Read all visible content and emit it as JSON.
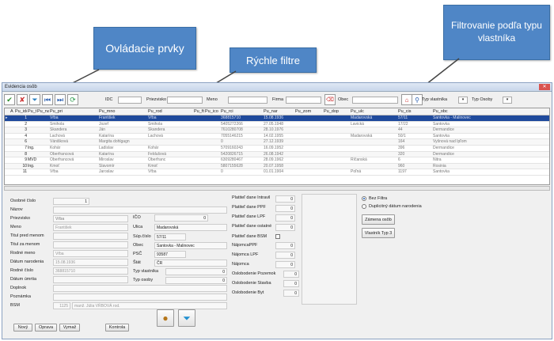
{
  "callouts": {
    "controls": "Ovládacie prvky",
    "quick_filters": "Rýchle filtre",
    "filter_by_type": "Filtrovanie podľa typu vlastníka"
  },
  "window": {
    "title": "Evidencia osôb",
    "close": "✕"
  },
  "toolbar": {
    "ok_icon": "✔",
    "cancel_icon": "✘",
    "filter_icon": "⏷",
    "prev_icon": "⏮",
    "next_icon": "⏭",
    "refresh_icon": "⟳"
  },
  "filters": {
    "idc_label": "IDC",
    "priezvisko_label": "Priezvisko",
    "meno_label": "Meno",
    "firma_label": "Firma",
    "obec_label": "Obec",
    "typ_vlastnika_label": "Typ vlastníka",
    "typ_osoby_label": "Typ Osoby"
  },
  "grid": {
    "columns": [
      "",
      "A",
      "Pu_idc",
      "Pu_ttp",
      "Pu_nac",
      "Pu_pri",
      "Pu_mno",
      "Pu_rod",
      "Pu_ftt",
      "Pu_ico",
      "Pu_rci",
      "Pu_nar",
      "Pu_zom",
      "Pu_dop",
      "Pu_ulc",
      "Pu_cis",
      "Pu_obc"
    ],
    "rows": [
      [
        "▸",
        "",
        "1",
        "",
        "",
        "Vŕba",
        "František",
        "Vŕba",
        "",
        "",
        "368815710",
        "15.08.1936",
        "",
        "",
        "Madarovská",
        "57/11",
        "Santovka - Malinovec"
      ],
      [
        "",
        "",
        "2",
        "",
        "",
        "Šmihola",
        "Jozef",
        "Šmihola",
        "",
        "",
        "5405272266",
        "27.05.1948",
        "",
        "",
        "Lavická",
        "17/22",
        "Santovka"
      ],
      [
        "",
        "",
        "3",
        "",
        "",
        "Škandera",
        "Ján",
        "Škandera",
        "",
        "",
        "7610280708",
        "28.10.1976",
        "",
        "",
        "",
        "44",
        "Dermandice"
      ],
      [
        "",
        "",
        "4",
        "",
        "",
        "Lachová",
        "Katarína",
        "Lachová",
        "",
        "",
        "7055146215",
        "14.02.1955",
        "",
        "",
        "Madarovská",
        "50/1",
        "Santovka"
      ],
      [
        "",
        "",
        "6",
        "",
        "",
        "Vánišková",
        "Margita dohlgagn",
        "",
        "",
        "",
        "0",
        "27.12.1939",
        "",
        "",
        "",
        "164",
        "Vyšnová nad Ipľom"
      ],
      [
        "",
        "",
        "7",
        "Ing.",
        "",
        "Kohár",
        "Ladislav",
        "Kohár",
        "",
        "",
        "5709160243",
        "16.09.1952",
        "",
        "",
        "",
        "396",
        "Dermandice"
      ],
      [
        "",
        "",
        "8",
        "",
        "",
        "Oberfrancová",
        "Katarína",
        "Feldušová",
        "",
        "",
        "5420826715",
        "26.08.1942",
        "",
        "",
        "",
        "320",
        "Dermandice"
      ],
      [
        "",
        "",
        "9",
        "MVDr.",
        "",
        "Oberfrancová",
        "Miroslav",
        "Oberfranc",
        "",
        "",
        "6309280467",
        "28.09.1962",
        "",
        "",
        "Ríčanská",
        "6",
        "Nitra"
      ],
      [
        "",
        "",
        "10",
        "Ing.",
        "",
        "Kmoť",
        "Slavomír",
        "Kmoť",
        "",
        "",
        "5807155628",
        "20.07.1958",
        "",
        "",
        "",
        "960",
        "Rosinia"
      ],
      [
        "",
        "",
        "11",
        "",
        "",
        "Vŕba",
        "Jaroslav",
        "Vŕba",
        "",
        "",
        "0",
        "01.01.1904",
        "",
        "",
        "Poľná",
        "1197",
        "Santovka"
      ]
    ]
  },
  "form": {
    "left_labels": [
      "Osobné číslo",
      "Názov",
      "Priezvisko",
      "Meno",
      "Titul pred menom",
      "Titul za menom",
      "Rodné meno",
      "Dátum narodenia",
      "Rodné číslo",
      "Dátum úmrtia",
      "Doplnok",
      "Poznámka",
      "BSM"
    ],
    "osobne_cislo": "1",
    "priezvisko": "Vŕba",
    "meno": "František",
    "rodne_meno": "Vŕba",
    "datum_narodenia": "15.08.1936",
    "rodne_cislo": "368815710",
    "bsm_num": "1125",
    "bsm_text": "manž. Júlia VŔBOVÁ rod.",
    "mid_labels": {
      "ico": "IČO",
      "ulica": "Ulica",
      "sup_cislo": "Súp.číslo",
      "obec": "Obec",
      "psc": "PSČ",
      "stat": "Štát",
      "typ_vlastnika": "Typ vlastníka",
      "typ_osoby": "Typ osoby"
    },
    "ico_val": "0",
    "ulica_val": "Madarovská",
    "sup_cislo_val": "57/11",
    "obec_val": "Santovka - Malinovec",
    "psc_val": "93587",
    "stat_val": "ČR",
    "typ_vlastnika_val": "0",
    "typ_osoby_val": "0",
    "right_labels": {
      "ppf_intravil": "Platiteľ dane Intravil",
      "ppf": "Platiteľ dane PPF",
      "lpf": "Platiteľ dane LPF",
      "ostatne": "Platiteľ dane ostatné",
      "bsm": "Platiteľ dane BSM",
      "najomca_ppf": "NájomcaPPF",
      "najomca_lpf": "Nájomca LPF",
      "najomca": "Nájomca",
      "oslob_pozemok": "Oslobodenie Pozemok",
      "oslob_stavba": "Oslobodenie Stavba",
      "oslob_byt": "Oslobodenie Byt"
    },
    "zero": "0",
    "radio_bez": "Bez Filtra",
    "radio_dup": "Duplicitný dátum narodenia",
    "btn_zamena": "Zámena osôb",
    "btn_vlastnik": "Vlastník Typ 3"
  },
  "bottom": {
    "novy": "Nový",
    "oprava": "Oprava",
    "vymaz": "Vymaž",
    "kontrola": "Kontrola"
  }
}
